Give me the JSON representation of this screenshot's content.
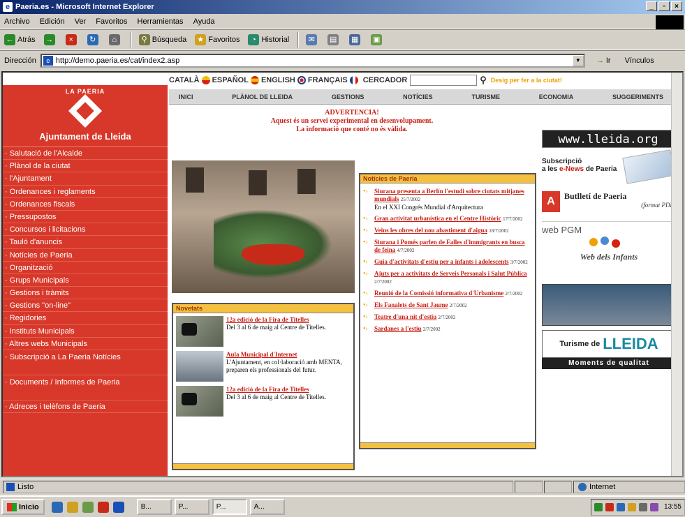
{
  "window": {
    "title": "Paeria.es - Microsoft Internet Explorer",
    "btn_min": "_",
    "btn_max": "▫",
    "btn_close": "×"
  },
  "menu": [
    "Archivo",
    "Edición",
    "Ver",
    "Favoritos",
    "Herramientas",
    "Ayuda"
  ],
  "toolbar": {
    "back": "Atrás",
    "forward": "→",
    "stop": "×",
    "refresh": "↻",
    "home": "⌂",
    "search": "Búsqueda",
    "favorites": "Favoritos",
    "history": "Historial"
  },
  "address": {
    "label": "Dirección",
    "url": "http://demo.paeria.es/cat/index2.asp",
    "go": "Ir",
    "links": "Vínculos"
  },
  "site": {
    "logo_top": "LA PAERIA",
    "logo_name": "Ajuntament de Lleida",
    "nav": [
      "· Salutació de l'Alcalde",
      "· Plànol de la ciutat",
      "· l'Ajuntament",
      "· Ordenances i reglaments",
      "· Ordenances fiscals",
      "· Pressupostos",
      "· Concursos i licitacions",
      "· Tauló d'anuncis",
      "· Notícies de Paeria",
      "· Organització",
      "· Grups Municipals",
      "· Gestions i tràmits",
      "· Gestions \"on-line\"",
      "· Regidories",
      "· Instituts Municipals",
      "· Altres webs Municipals",
      "· Subscripció a La Paeria Notícies",
      "· Documents / Informes de Paeria",
      "· Adreces i telèfons de Paeria"
    ],
    "langs": [
      "CATALÀ",
      "ESPAÑOL",
      "ENGLISH",
      "FRANÇAIS"
    ],
    "search_label": "CERCADOR",
    "search_value": "",
    "search_hint": "Desig per fer a la ciutat!",
    "mainnav": [
      "INICI",
      "PLÀNOL DE LLEIDA",
      "GESTIONS",
      "NOTÍCIES",
      "TURISME",
      "ECONOMIA",
      "SUGGERIMENTS"
    ],
    "warning": {
      "title": "ADVERTENCIA!",
      "line1": "Aquest és un servei experimental en desenvolupament.",
      "line2": "La informació que conté no és vàlida."
    },
    "novetats": {
      "header": "Novetats",
      "items": [
        {
          "title": "12a edició de la Fira de Titelles",
          "text": "Del 3 al 6 de maig al Centre de Titelles."
        },
        {
          "title": "Aula Municipal d'Internet",
          "text": "L'Ajuntament, en col·laboració amb MENTA, preparen els professionals del futur."
        },
        {
          "title": "12a edició de la Fira de Titelles",
          "text": "Del 3 al 6 de maig al Centre de Titelles."
        }
      ]
    },
    "news": {
      "header": "Notícies de Paeria",
      "items": [
        {
          "title": "Siurana presenta a Berlín l'estudi sobre ciutats mitjanes mundials",
          "date": "25/7/2002",
          "summary": "En el XXI Congrés Mundial d'Arquitectura"
        },
        {
          "title": "Gran activitat urbanística en el Centre Històric",
          "date": "17/7/2002"
        },
        {
          "title": "Veïns les obres del nou abastiment d'aigua",
          "date": "18/7/2002"
        },
        {
          "title": "Siurana i Pomés parlen de Falles d'immigrants en busca de feina",
          "date": "4/7/2002"
        },
        {
          "title": "Guia d'activitats d'estiu per a infants i adolescents",
          "date": "3/7/2002"
        },
        {
          "title": "Ajuts per a activitats de Serveis Personals i Salut Pública",
          "date": "2/7/2002"
        },
        {
          "title": "Reunió de la Comissió informativa d'Urbanisme",
          "date": "2/7/2002"
        },
        {
          "title": "Els Fanalets de Sant Jaume",
          "date": "2/7/2002"
        },
        {
          "title": "Teatre d'una nit d'estiu",
          "date": "2/7/2002"
        },
        {
          "title": "Sardanes a l'estiu",
          "date": "2/7/2002"
        }
      ]
    },
    "right": {
      "lleida_org": "www.lleida.org",
      "subs_line1": "Subscripció",
      "subs_line2a": "a les ",
      "subs_line2b": "e-News",
      "subs_line2c": " de Paeria",
      "butlleti": "Butlletí de Paeria",
      "butlleti_format": "(format PDF)",
      "pdf_icon": "A",
      "pgm": "web PGM",
      "infants": "Web dels Infants",
      "turisme": "Turisme de",
      "turisme_logo": "LLEIDA",
      "moments": "Moments de qualitat"
    }
  },
  "status": {
    "text": "Listo",
    "zone": "Internet"
  },
  "taskbar": {
    "start": "Inicio",
    "tasks": [
      "B...",
      "P...",
      "P...",
      "A..."
    ],
    "clock": "13:55"
  },
  "colors": {
    "accent_red": "#d8382a",
    "header_yellow": "#f4c040",
    "link_red": "#c81e14"
  }
}
